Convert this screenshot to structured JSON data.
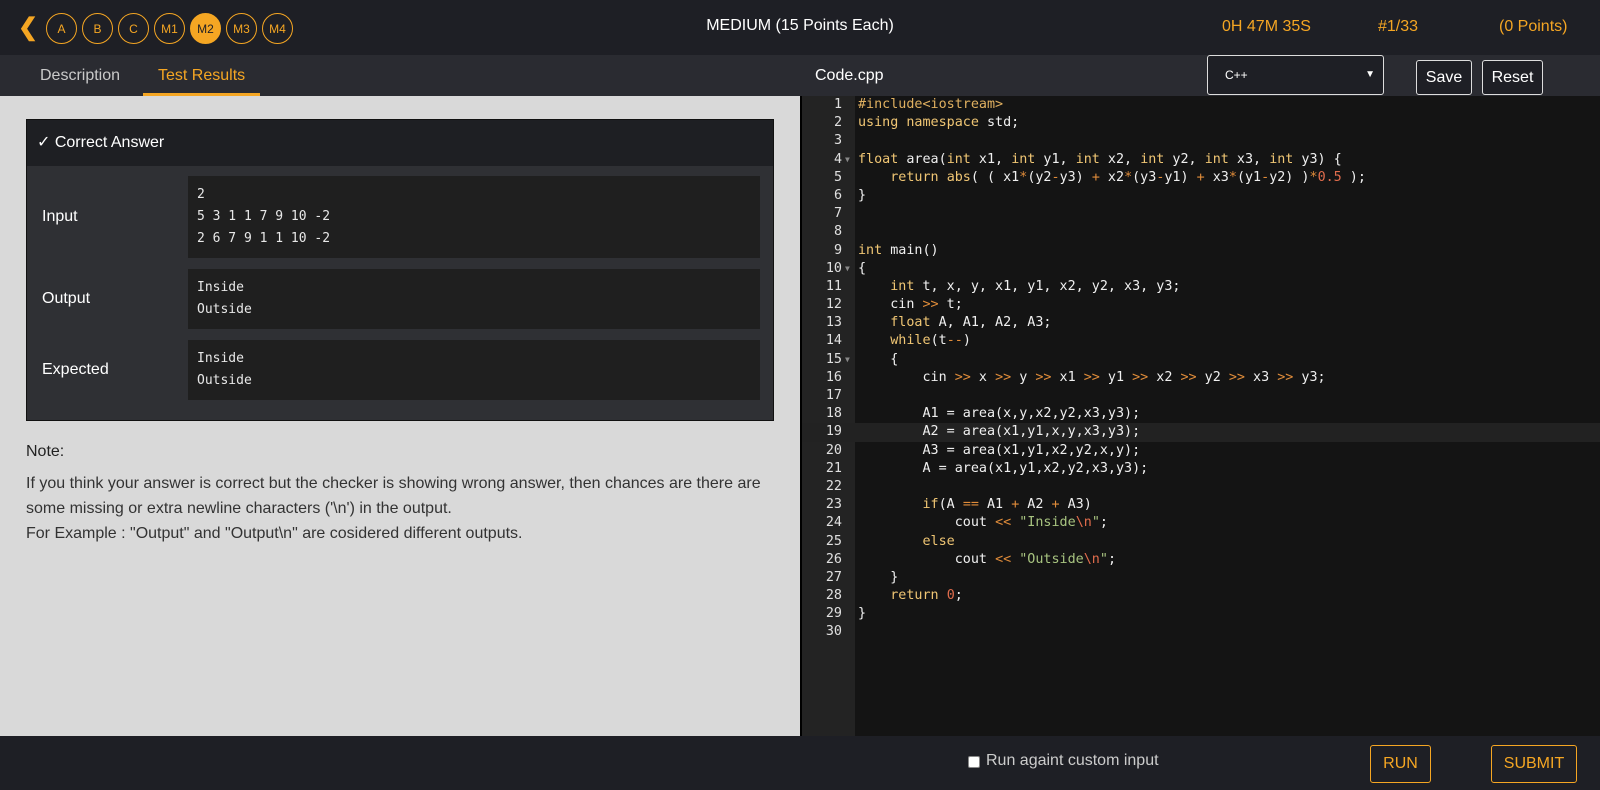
{
  "header": {
    "back_icon": "chevron-left-icon",
    "questions": [
      "A",
      "B",
      "C",
      "M1",
      "M2",
      "M3",
      "M4"
    ],
    "active_question": "M2",
    "level_title": "MEDIUM (15 Points Each)",
    "timer": "0H 47M 35S",
    "question_count": "#1/33",
    "points": "(0 Points)",
    "accent_color": "#f5a623"
  },
  "tabs": {
    "description": "Description",
    "test_results": "Test Results"
  },
  "editor_bar": {
    "filename": "Code.cpp",
    "language": "C++",
    "save_label": "Save",
    "reset_label": "Reset"
  },
  "result": {
    "header": "✓ Correct Answer",
    "input_label": "Input",
    "input_value": "2\n5 3 1 1 7 9 10 -2\n2 6 7 9 1 1 10 -2",
    "output_label": "Output",
    "output_value": "Inside\nOutside",
    "expected_label": "Expected",
    "expected_value": "Inside\nOutside"
  },
  "note": {
    "title": "Note:",
    "line1": "If you think your answer is correct but the checker is showing wrong answer, then chances are there are some missing or extra newline characters ('\\n') in the output.",
    "line2": "For Example : \"Output\" and \"Output\\n\" are cosidered different outputs."
  },
  "code": {
    "active_line": 19,
    "fold_lines": [
      4,
      10,
      15
    ],
    "lines": [
      "#include<iostream>",
      "using namespace std;",
      "",
      "float area(int x1, int y1, int x2, int y2, int x3, int y3) {",
      "    return abs( ( x1*(y2-y3) + x2*(y3-y1) + x3*(y1-y2) )*0.5 );",
      "}",
      "",
      "",
      "int main()",
      "{",
      "    int t, x, y, x1, y1, x2, y2, x3, y3;",
      "    cin >> t;",
      "    float A, A1, A2, A3;",
      "    while(t--)",
      "    {",
      "        cin >> x >> y >> x1 >> y1 >> x2 >> y2 >> x3 >> y3;",
      "",
      "        A1 = area(x,y,x2,y2,x3,y3);",
      "        A2 = area(x1,y1,x,y,x3,y3);",
      "        A3 = area(x1,y1,x2,y2,x,y);",
      "        A = area(x1,y1,x2,y2,x3,y3);",
      "",
      "        if(A == A1 + A2 + A3)",
      "            cout << \"Inside\\n\";",
      "        else",
      "            cout << \"Outside\\n\";",
      "    }",
      "    return 0;",
      "}",
      ""
    ]
  },
  "footer": {
    "custom_input_label": "Run againt custom input",
    "run_label": "RUN",
    "submit_label": "SUBMIT"
  }
}
